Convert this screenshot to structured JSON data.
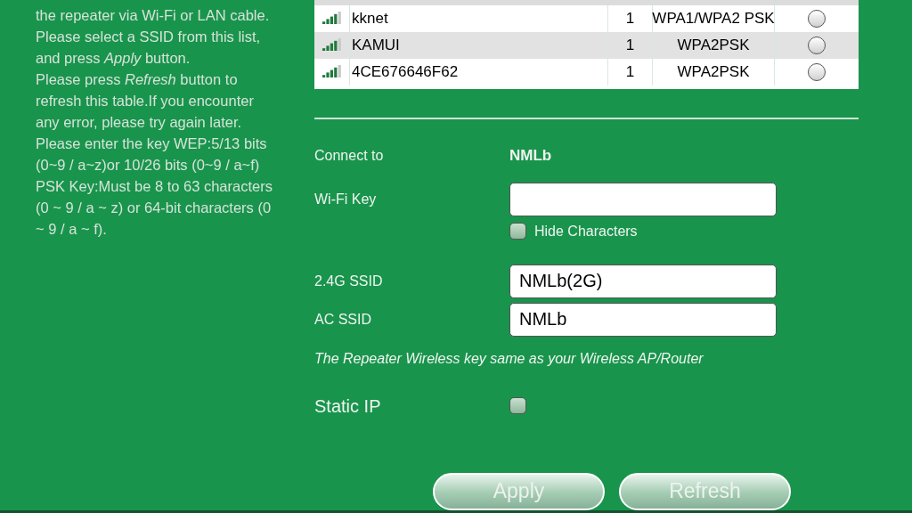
{
  "help_text": [
    "the repeater via Wi-Fi or LAN cable.",
    "Please select a SSID from this list, and press *Apply* button.",
    "Please press *Refresh* button to refresh this table.If you encounter any error, please try again later.",
    "Please enter the key WEP:5/13 bits (0~9 / a~z)or 10/26 bits (0~9 / a~f)",
    "PSK Key:Must be 8 to 63 characters (0 ~ 9 / a ~ z) or 64-bit characters (0 ~ 9 / a ~ f)."
  ],
  "networks": [
    {
      "ssid": "kknet",
      "channel": "1",
      "security": "WPA1/WPA2 PSK",
      "selected": false
    },
    {
      "ssid": "KAMUI",
      "channel": "1",
      "security": "WPA2PSK",
      "selected": false
    },
    {
      "ssid": "4CE676646F62",
      "channel": "1",
      "security": "WPA2PSK",
      "selected": false
    }
  ],
  "connect_to": {
    "label": "Connect to",
    "value": "NMLb"
  },
  "wifi_key": {
    "label": "Wi-Fi Key"
  },
  "hide_characters": {
    "label": "Hide Characters",
    "checked": false
  },
  "ssid_24g": {
    "label": "2.4G SSID",
    "value": "NMLb(2G)"
  },
  "ssid_ac": {
    "label": "AC SSID",
    "value": "NMLb"
  },
  "note": "The Repeater Wireless key same as your Wireless AP/Router",
  "static_ip": {
    "label": "Static IP",
    "checked": false
  },
  "buttons": [
    "Apply",
    "Refresh"
  ]
}
